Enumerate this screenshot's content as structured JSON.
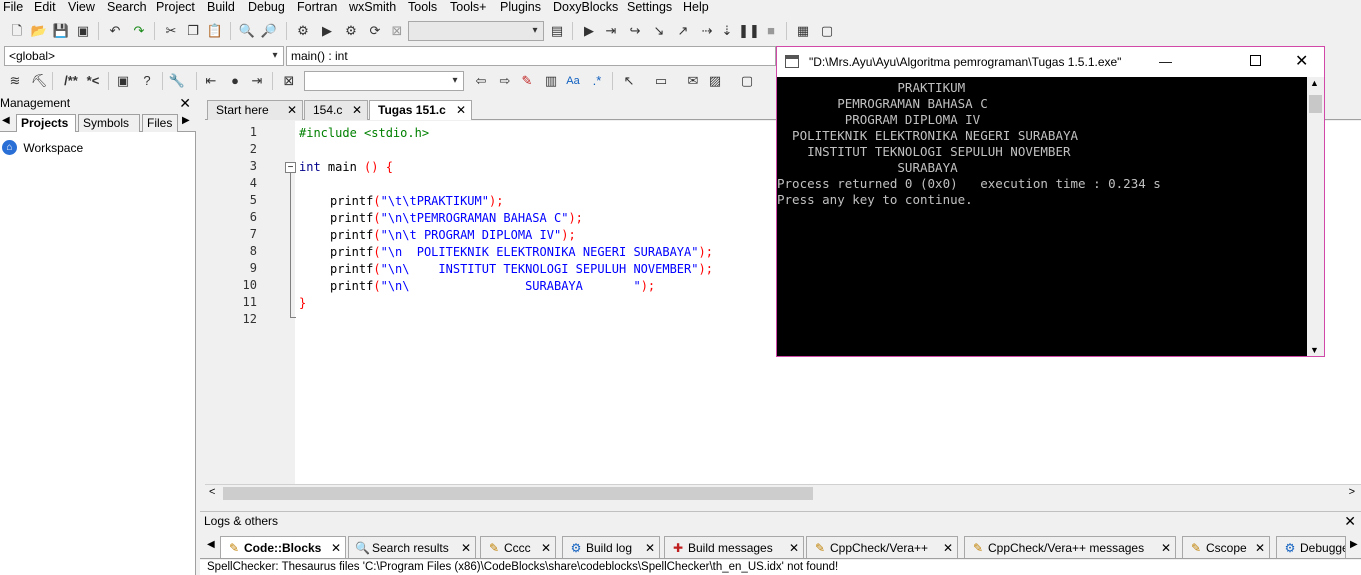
{
  "menu": [
    "File",
    "Edit",
    "View",
    "Search",
    "Project",
    "Build",
    "Debug",
    "Fortran",
    "wxSmith",
    "Tools",
    "Tools+",
    "Plugins",
    "DoxyBlocks",
    "Settings",
    "Help"
  ],
  "scope_combo": "<global>",
  "function_combo": "main() : int",
  "doxy_labels": {
    "block": "/**",
    "line": "*<"
  },
  "left_panel": {
    "title": "Management",
    "tabs": [
      "Projects",
      "Symbols",
      "Files"
    ],
    "tree_root": "Workspace"
  },
  "editor_tabs": [
    "Start here",
    "154.c",
    "Tugas 151.c"
  ],
  "code": {
    "line_numbers": [
      "1",
      "2",
      "3",
      "4",
      "5",
      "6",
      "7",
      "8",
      "9",
      "10",
      "11",
      "12"
    ],
    "include": "#include <stdio.h>",
    "main_kw": "int",
    "main_name": " main ",
    "main_parens": "() {",
    "printf": "printf",
    "strings": [
      "\"\\t\\tPRAKTIKUM\"",
      "\"\\n\\tPEMROGRAMAN BAHASA C\"",
      "\"\\n\\t PROGRAM DIPLOMA IV\"",
      "\"\\n  POLITEKNIK ELEKTRONIKA NEGERI SURABAYA\"",
      "\"\\n\\    INSTITUT TEKNOLOGI SEPULUH NOVEMBER\"",
      "\"\\n\\                SURABAYA       \""
    ],
    "close_brace": "}"
  },
  "logs": {
    "title": "Logs & others",
    "tabs": [
      "Code::Blocks",
      "Search results",
      "Cccc",
      "Build log",
      "Build messages",
      "CppCheck/Vera++",
      "CppCheck/Vera++ messages",
      "Cscope",
      "Debugge"
    ],
    "status": "SpellChecker: Thesaurus files 'C:\\Program Files (x86)\\CodeBlocks\\share\\codeblocks\\SpellChecker\\th_en_US.idx' not found!"
  },
  "console": {
    "title": "\"D:\\Mrs.Ayu\\Ayu\\Algoritma pemrograman\\Tugas 1.5.1.exe\"",
    "lines": [
      "                PRAKTIKUM",
      "        PEMROGRAMAN BAHASA C",
      "         PROGRAM DIPLOMA IV",
      "  POLITEKNIK ELEKTRONIKA NEGERI SURABAYA",
      "    INSTITUT TEKNOLOGI SEPULUH NOVEMBER",
      "                SURABAYA",
      "Process returned 0 (0x0)   execution time : 0.234 s",
      "Press any key to continue."
    ]
  }
}
